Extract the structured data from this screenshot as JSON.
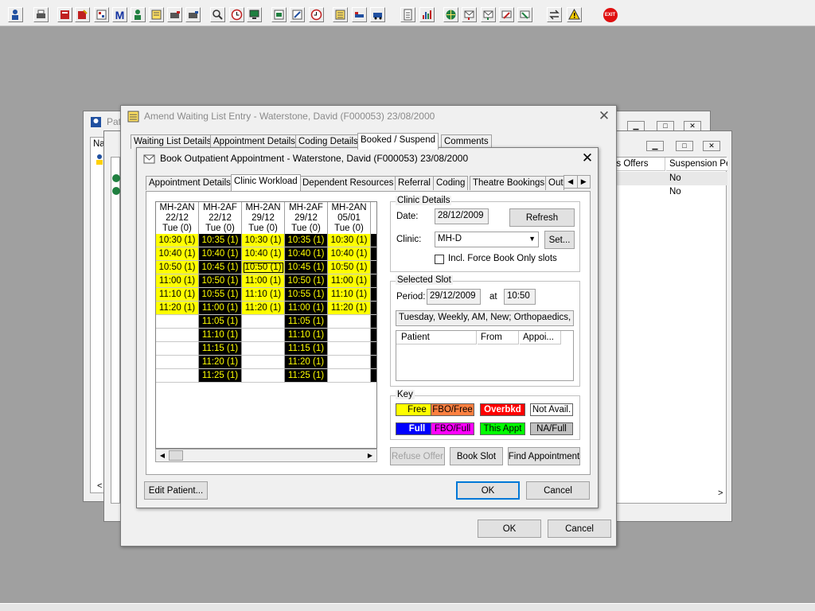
{
  "toolbar_icons": [
    "user-icon",
    "printer-icon",
    "book-icon",
    "edit-book-icon",
    "form-icon",
    "m-icon",
    "person-icon",
    "note-icon",
    "camera-icon",
    "camera2-icon",
    "search-icon",
    "clock-icon",
    "monitor-icon",
    "image-icon",
    "pencil-icon",
    "clock2-icon",
    "list-icon",
    "bed-icon",
    "ambulance-icon",
    "document-icon",
    "chart-icon",
    "globe-icon",
    "letter-icon",
    "letter2-icon",
    "letter3-icon",
    "swap-icon",
    "warning-icon",
    "exit-icon"
  ],
  "toolbar_exit_label": "EXIT",
  "toolbar_m_label": "M",
  "bg_window1": {
    "title_stub": "Pat",
    "col_stub": "Na"
  },
  "bg_window2": {
    "col1": "us Offers",
    "col2": "Suspension Pe",
    "rows": [
      {
        "v": "No"
      },
      {
        "v": "No"
      }
    ],
    "scroll_left": "<",
    "scroll_right": ">"
  },
  "amend": {
    "title": "Amend Waiting List Entry - Waterstone, David (F000053) 23/08/2000",
    "tabs": [
      "Waiting List Details",
      "Appointment Details",
      "Coding Details",
      "Booked / Suspend",
      "Comments"
    ],
    "ok": "OK",
    "cancel": "Cancel"
  },
  "book": {
    "title": "Book Outpatient Appointment - Waterstone, David (F000053) 23/08/2000",
    "tabs": [
      "Appointment Details",
      "Clinic Workload",
      "Dependent Resources",
      "Referral",
      "Coding",
      "Theatre Bookings",
      "Out"
    ],
    "grid_columns": [
      {
        "h1": "MH-2AN",
        "h2": "22/12",
        "h3": "Tue  (0)",
        "slots": [
          "10:30 (1)",
          "10:40 (1)",
          "10:50 (1)",
          "11:00 (1)",
          "11:10 (1)",
          "11:20 (1)",
          "",
          "",
          "",
          "",
          "",
          ""
        ],
        "style": "yl"
      },
      {
        "h1": "MH-2AF",
        "h2": "22/12",
        "h3": "Tue  (0)",
        "slots": [
          "10:35 (1)",
          "10:40 (1)",
          "10:45 (1)",
          "10:50 (1)",
          "10:55 (1)",
          "11:00 (1)",
          "11:05 (1)",
          "11:10 (1)",
          "11:15 (1)",
          "11:20 (1)",
          "11:25 (1)",
          ""
        ],
        "style": "bk"
      },
      {
        "h1": "MH-2AN",
        "h2": "29/12",
        "h3": "Tue  (0)",
        "slots": [
          "10:30 (1)",
          "10:40 (1)",
          "10:50 (1)",
          "11:00 (1)",
          "11:10 (1)",
          "11:20 (1)",
          "",
          "",
          "",
          "",
          "",
          ""
        ],
        "style": "yl"
      },
      {
        "h1": "MH-2AF",
        "h2": "29/12",
        "h3": "Tue  (0)",
        "slots": [
          "10:35 (1)",
          "10:40 (1)",
          "10:45 (1)",
          "10:50 (1)",
          "10:55 (1)",
          "11:00 (1)",
          "11:05 (1)",
          "11:10 (1)",
          "11:15 (1)",
          "11:20 (1)",
          "11:25 (1)",
          ""
        ],
        "style": "bk"
      },
      {
        "h1": "MH-2AN",
        "h2": "05/01",
        "h3": "Tue  (0)",
        "slots": [
          "10:30 (1)",
          "10:40 (1)",
          "10:50 (1)",
          "11:00 (1)",
          "11:10 (1)",
          "11:20 (1)",
          "",
          "",
          "",
          "",
          "",
          ""
        ],
        "style": "yl"
      }
    ],
    "clinic_details": {
      "caption": "Clinic Details",
      "date_label": "Date:",
      "date_value": "28/12/2009",
      "refresh": "Refresh",
      "clinic_label": "Clinic:",
      "clinic_value": "MH-D",
      "set": "Set...",
      "force_label": "Incl. Force Book Only slots"
    },
    "selected_slot": {
      "caption": "Selected Slot",
      "period_label": "Period:",
      "period_value": "29/12/2009",
      "at_label": "at",
      "time_value": "10:50",
      "description": "Tuesday, Weekly, AM, New; Orthopaedics, Or",
      "list_headers": [
        "Patient",
        "From",
        "Appoi..."
      ]
    },
    "key": {
      "caption": "Key",
      "items": [
        {
          "label": "Free",
          "bg": "#ffff00",
          "fg": "#000000"
        },
        {
          "label": "FBO/Free",
          "bg": "#ff8040",
          "fg": "#000000"
        },
        {
          "label": "Overbkd",
          "bg": "#ff0000",
          "fg": "#ffffff"
        },
        {
          "label": "Not Avail.",
          "bg": "#ffffff",
          "fg": "#000000"
        },
        {
          "label": "Full",
          "bg": "#0000ff",
          "fg": "#ffffff"
        },
        {
          "label": "FBO/Full",
          "bg": "#ff00ff",
          "fg": "#000000"
        },
        {
          "label": "This Appt",
          "bg": "#00ff00",
          "fg": "#000000"
        },
        {
          "label": "NA/Full",
          "bg": "#c0c0c0",
          "fg": "#000000"
        }
      ]
    },
    "refuse_offer": "Refuse Offer",
    "book_slot": "Book Slot",
    "find_appointment": "Find Appointment",
    "edit_patient": "Edit Patient...",
    "ok": "OK",
    "cancel": "Cancel"
  }
}
